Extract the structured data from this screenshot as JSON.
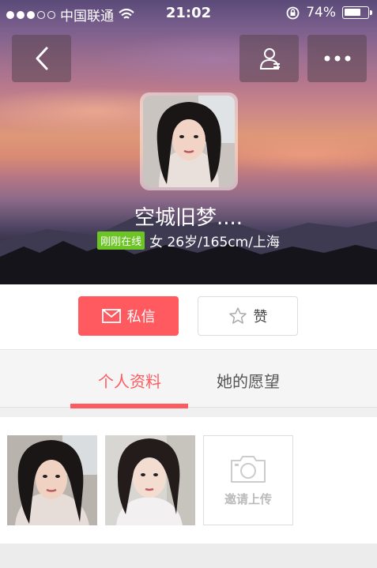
{
  "status_bar": {
    "carrier": "中国联通",
    "time": "21:02",
    "battery": "74%",
    "battery_level": 0.74
  },
  "header": {
    "back_icon": "chevron-left-icon",
    "profile_icon": "user-profile-icon",
    "more_icon": "more-dots-icon"
  },
  "profile": {
    "name": "空城旧梦....",
    "online_badge": "刚刚在线",
    "details": "女 26岁/165cm/上海"
  },
  "actions": {
    "message_label": "私信",
    "like_label": "赞",
    "message_color": "#fe5a5f"
  },
  "tabs": [
    {
      "label": "个人资料",
      "active": true
    },
    {
      "label": "她的愿望",
      "active": false
    }
  ],
  "photos": {
    "upload_label": "邀请上传",
    "upload_icon": "camera-icon"
  },
  "colors": {
    "accent": "#fe5a5f",
    "online": "#6cc425"
  }
}
